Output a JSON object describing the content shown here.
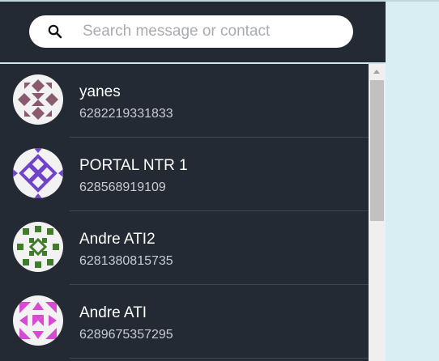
{
  "search": {
    "placeholder": "Search message or contact",
    "icon": "search-icon"
  },
  "contacts": [
    {
      "name": "yanes",
      "phone": "6282219331833",
      "avatar_color": "#8a5a6e"
    },
    {
      "name": "PORTAL NTR 1",
      "phone": "628568919109",
      "avatar_color": "#7043c9"
    },
    {
      "name": "Andre ATI2",
      "phone": "6281380815735",
      "avatar_color": "#3f7d2a"
    },
    {
      "name": "Andre ATI",
      "phone": "6289675357295",
      "avatar_color": "#d64bd1"
    }
  ],
  "colors": {
    "panel": "#232a33",
    "background": "#d9eef3"
  }
}
